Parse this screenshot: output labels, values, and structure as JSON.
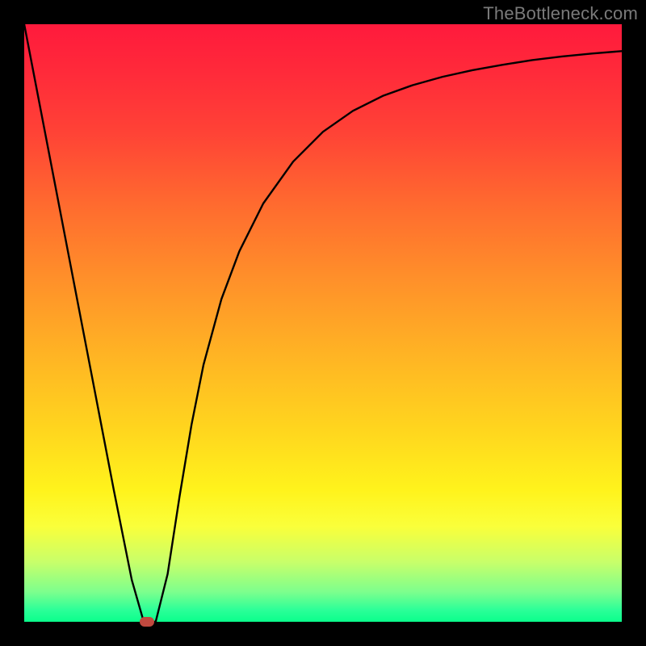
{
  "watermark": "TheBottleneck.com",
  "chart_data": {
    "type": "line",
    "title": "",
    "xlabel": "",
    "ylabel": "",
    "xlim": [
      0,
      100
    ],
    "ylim": [
      0,
      100
    ],
    "series": [
      {
        "name": "bottleneck-curve",
        "x": [
          0,
          5,
          10,
          15,
          18,
          20,
          22,
          24,
          26,
          28,
          30,
          33,
          36,
          40,
          45,
          50,
          55,
          60,
          65,
          70,
          75,
          80,
          85,
          90,
          95,
          100
        ],
        "values": [
          100,
          74,
          48,
          22,
          7,
          0,
          0,
          8,
          21,
          33,
          43,
          54,
          62,
          70,
          77,
          82,
          85.5,
          88,
          89.8,
          91.2,
          92.3,
          93.2,
          94,
          94.6,
          95.1,
          95.5
        ]
      }
    ],
    "marker": {
      "x": 20.5,
      "y": 0
    },
    "background_gradient": {
      "top": "#ff1a3c",
      "mid": "#ffd61e",
      "bottom": "#0aff8c"
    }
  }
}
